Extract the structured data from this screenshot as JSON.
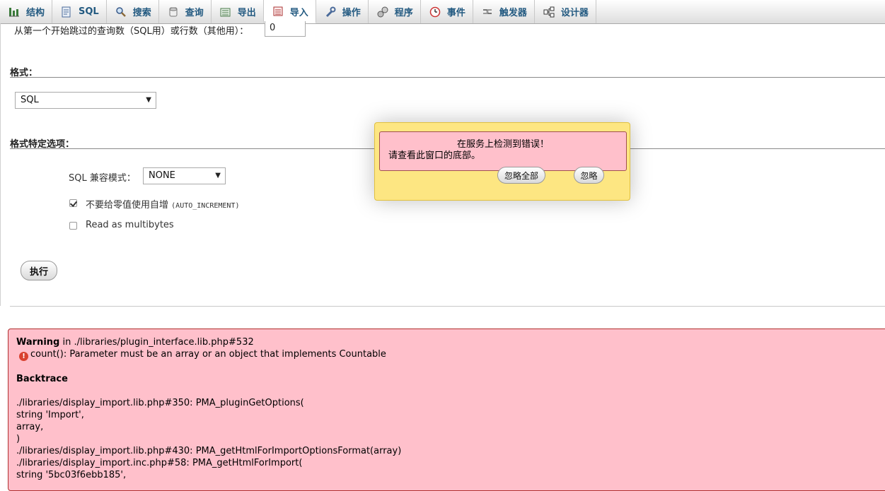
{
  "tabs": [
    {
      "label": "结构",
      "icon": "structure-icon"
    },
    {
      "label": "SQL",
      "icon": "sql-icon"
    },
    {
      "label": "搜索",
      "icon": "search-icon"
    },
    {
      "label": "查询",
      "icon": "query-icon"
    },
    {
      "label": "导出",
      "icon": "export-icon"
    },
    {
      "label": "导入",
      "icon": "import-icon",
      "active": true
    },
    {
      "label": "操作",
      "icon": "wrench-icon"
    },
    {
      "label": "程序",
      "icon": "routines-icon"
    },
    {
      "label": "事件",
      "icon": "clock-icon"
    },
    {
      "label": "触发器",
      "icon": "triggers-icon"
    },
    {
      "label": "设计器",
      "icon": "designer-icon"
    }
  ],
  "form": {
    "skip_label": "从第一个开始跳过的查询数（SQL用）或行数（其他用）：",
    "skip_value": "0",
    "format_title": "格式：",
    "format_value": "SQL",
    "format_options_title": "格式特定选项：",
    "sql_compat_label": "SQL 兼容模式：",
    "sql_compat_value": "NONE",
    "no_auto_value_label": "不要给零值使用自增",
    "no_auto_value_code": "(AUTO_INCREMENT)",
    "no_auto_value_checked": true,
    "read_multibytes_label": "Read as multibytes",
    "read_multibytes_checked": false,
    "go_button": "执行"
  },
  "popup": {
    "line1": "在服务上检测到错误！",
    "line2": "请查看此窗口的底部。",
    "ignore_all_button": "忽略全部",
    "ignore_button": "忽略"
  },
  "error": {
    "warning_label": "Warning",
    "warning_location": " in ./libraries/plugin_interface.lib.php#532",
    "message": "count(): Parameter must be an array or an object that implements Countable",
    "backtrace_title": "Backtrace",
    "lines": [
      "./libraries/display_import.lib.php#350: PMA_pluginGetOptions(",
      "string 'Import',",
      "array,",
      ")",
      "./libraries/display_import.lib.php#430: PMA_getHtmlForImportOptionsFormat(array)",
      "./libraries/display_import.inc.php#58: PMA_getHtmlForImport(",
      "string '5bc03f6ebb185',"
    ]
  },
  "colors": {
    "tab_text": "#235a81",
    "error_bg": "#ffc0cb",
    "popup_bg": "#fde682"
  }
}
